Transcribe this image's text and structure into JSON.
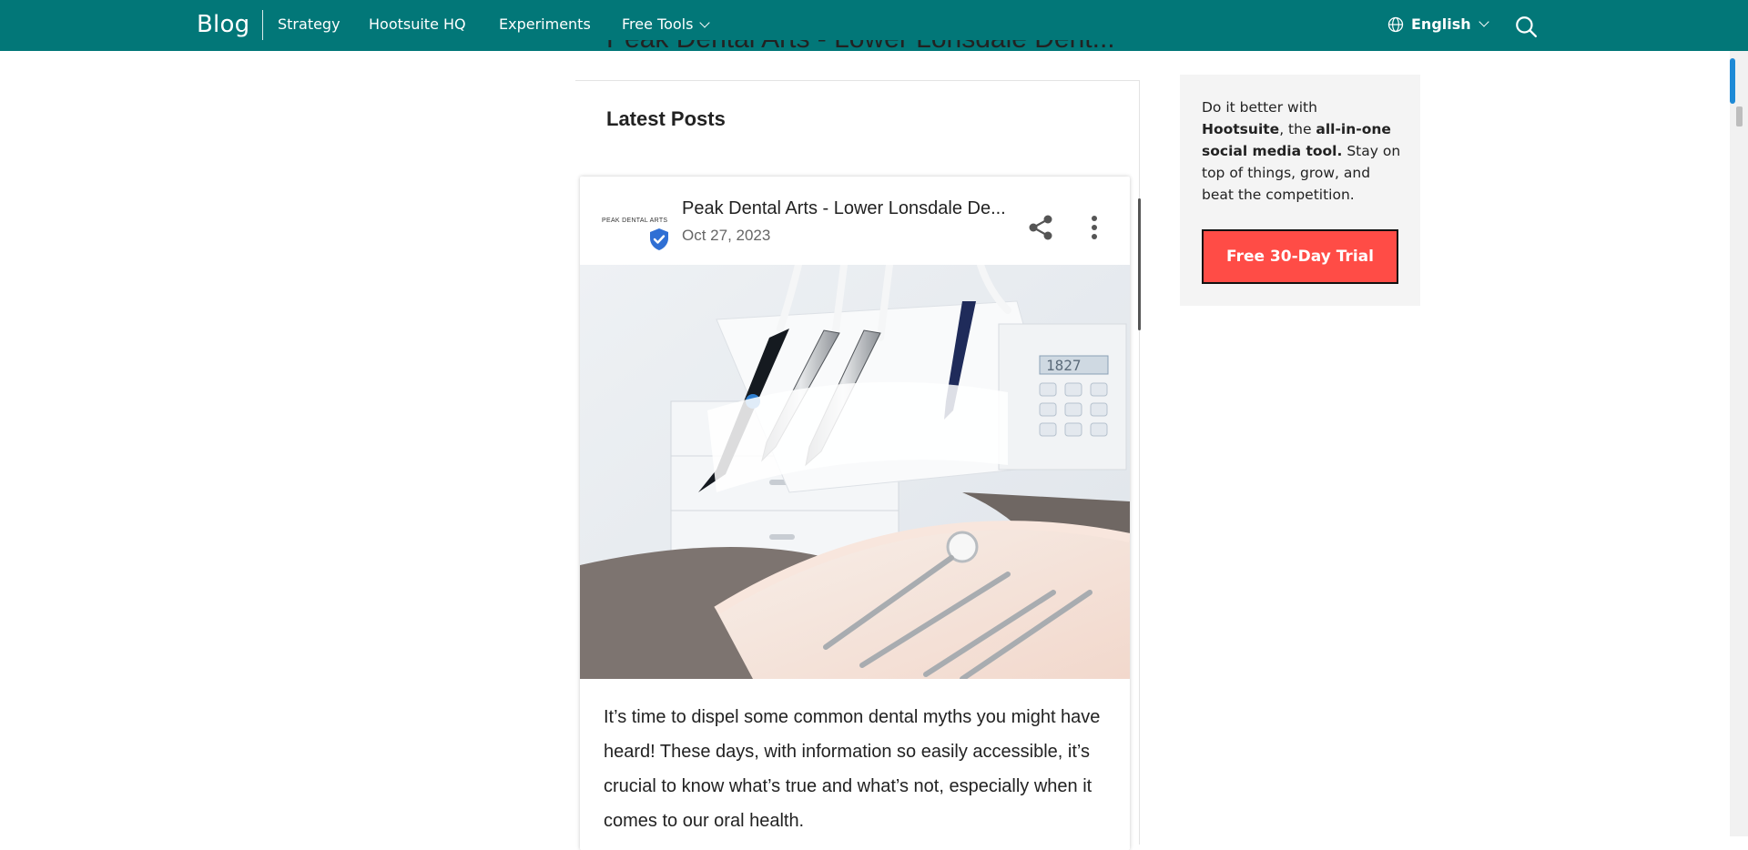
{
  "nav": {
    "brand": "Blog",
    "items": [
      "Strategy",
      "Hootsuite HQ",
      "Experiments",
      "Free Tools"
    ],
    "language": "English"
  },
  "article": {
    "cut_off_title": "Peak Dental Arts - Lower Lonsdale Dent..."
  },
  "widget": {
    "heading": "Latest Posts",
    "post": {
      "logo_text": "PEAK DENTAL ARTS",
      "title": "Peak Dental Arts - Lower Lonsdale De...",
      "date": "Oct 27, 2023",
      "body": "It’s time to dispel some common dental myths you might have heard! These days, with information so easily accessible, it’s crucial to know what’s true and what’s not, especially when it comes to our oral health.",
      "image_display": "1827"
    }
  },
  "promo": {
    "line1": "Do it better with",
    "brand": "Hootsuite",
    "mid": ", the ",
    "highlight": "all-in-one social media tool.",
    "tail": " Stay on top of things, grow, and beat the competition.",
    "button_label": "Free 30-Day Trial"
  },
  "colors": {
    "nav_bg": "#027778",
    "cta_bg": "#ff4c46",
    "verified_blue": "#2f6fd4"
  }
}
